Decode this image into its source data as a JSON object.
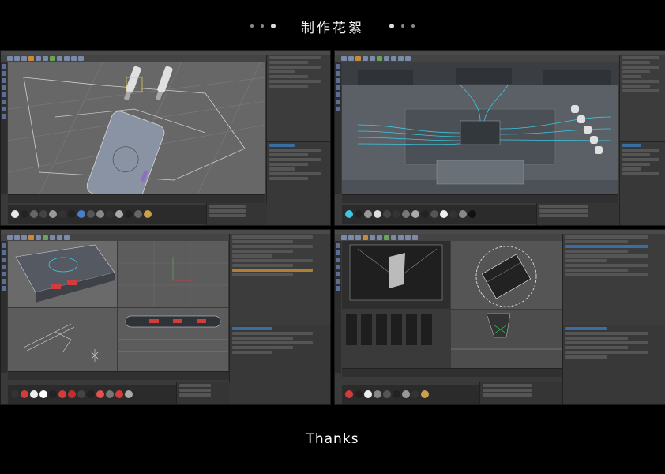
{
  "header": {
    "title": "制作花絮"
  },
  "footer": {
    "text": "Thanks"
  },
  "screenshots": [
    {
      "id": "power-bank-cables",
      "description_icon": "viewport-3d"
    },
    {
      "id": "circuit-chip-scene",
      "description_icon": "viewport-3d"
    },
    {
      "id": "power-bank-four-view",
      "description_icon": "viewport-3d"
    },
    {
      "id": "device-interior-scene",
      "description_icon": "viewport-3d"
    }
  ],
  "colors": {
    "background": "#000000",
    "ui_panel": "#3a3a3a",
    "viewport": "#5a5a5a",
    "accent_cyan": "#3ec6e0",
    "accent_red": "#d23c3c"
  }
}
